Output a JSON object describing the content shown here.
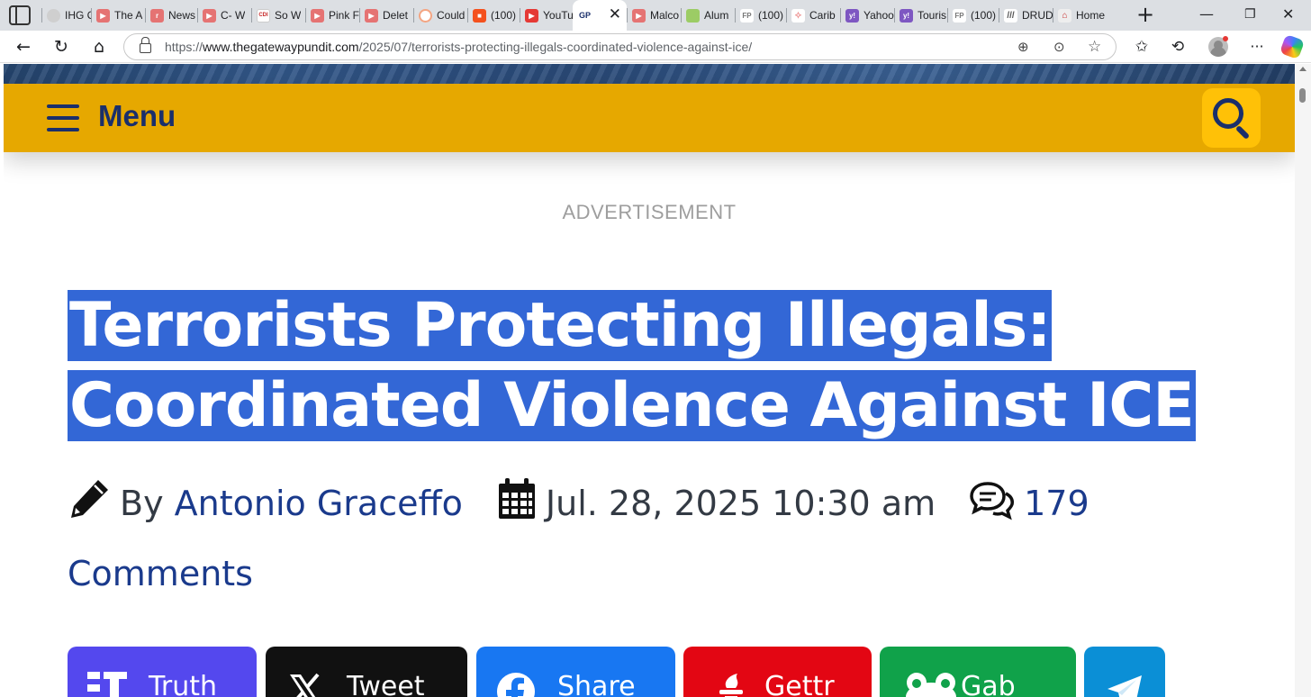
{
  "browser": {
    "tabs": [
      {
        "label": "IHG C",
        "favicon": "ihg",
        "color": "#9e9e9e"
      },
      {
        "label": "The A",
        "favicon": "youtube",
        "color": "#e57373"
      },
      {
        "label": "News",
        "favicon": "r",
        "color": "#e57373"
      },
      {
        "label": "C- W",
        "favicon": "youtube",
        "color": "#e57373"
      },
      {
        "label": "So W",
        "favicon": "cdi",
        "color": "#ffffff"
      },
      {
        "label": "Pink F",
        "favicon": "youtube",
        "color": "#e57373"
      },
      {
        "label": "Delet",
        "favicon": "youtube",
        "color": "#e57373"
      },
      {
        "label": "Could",
        "favicon": "spiral",
        "color": "#f4a582"
      },
      {
        "label": "(100)",
        "favicon": "bookmark",
        "color": "#f4511e"
      },
      {
        "label": "YouTu",
        "favicon": "youtube",
        "color": "#e53935"
      },
      {
        "label": "",
        "favicon": "GP",
        "color": "#ffffff",
        "active": true
      },
      {
        "label": "Malco",
        "favicon": "youtube",
        "color": "#e57373"
      },
      {
        "label": "Alum",
        "favicon": "map",
        "color": "#9ccc65"
      },
      {
        "label": "(100)",
        "favicon": "FP",
        "color": "#bdbdbd"
      },
      {
        "label": "Carib",
        "favicon": "bird",
        "color": "#ef9a9a"
      },
      {
        "label": "Yahoo",
        "favicon": "y!",
        "color": "#7e57c2"
      },
      {
        "label": "Touris",
        "favicon": "y!",
        "color": "#7e57c2"
      },
      {
        "label": "(100)",
        "favicon": "FP",
        "color": "#bdbdbd"
      },
      {
        "label": "DRUD",
        "favicon": "drudge",
        "color": "#757575"
      },
      {
        "label": "Home",
        "favicon": "home",
        "color": "#e0e0e0"
      }
    ],
    "url_prefix": "https://",
    "url_host": "www.thegatewaypundit.com",
    "url_path": "/2025/07/terrorists-protecting-illegals-coordinated-violence-against-ice/"
  },
  "nav": {
    "menu_label": "Menu"
  },
  "ad": {
    "label": "ADVERTISEMENT"
  },
  "article": {
    "headline": "Terrorists Protecting Illegals: Coordinated Violence Against ICE",
    "by_label": "By",
    "author": "Antonio Graceffo",
    "date": "Jul. 28, 2025 10:30 am",
    "comments": "179 Comments"
  },
  "share": [
    {
      "label": "Truth",
      "color": "#5448ee",
      "icon": "T"
    },
    {
      "label": "Tweet",
      "color": "#111111",
      "icon": "X"
    },
    {
      "label": "Share",
      "color": "#1877f2",
      "icon": "f"
    },
    {
      "label": "Gettr",
      "color": "#e30613",
      "icon": "gettr"
    },
    {
      "label": "Gab",
      "color": "#10a24a",
      "icon": "frog"
    },
    {
      "label": "",
      "color": "#0b8fd6",
      "icon": "telegram"
    }
  ]
}
